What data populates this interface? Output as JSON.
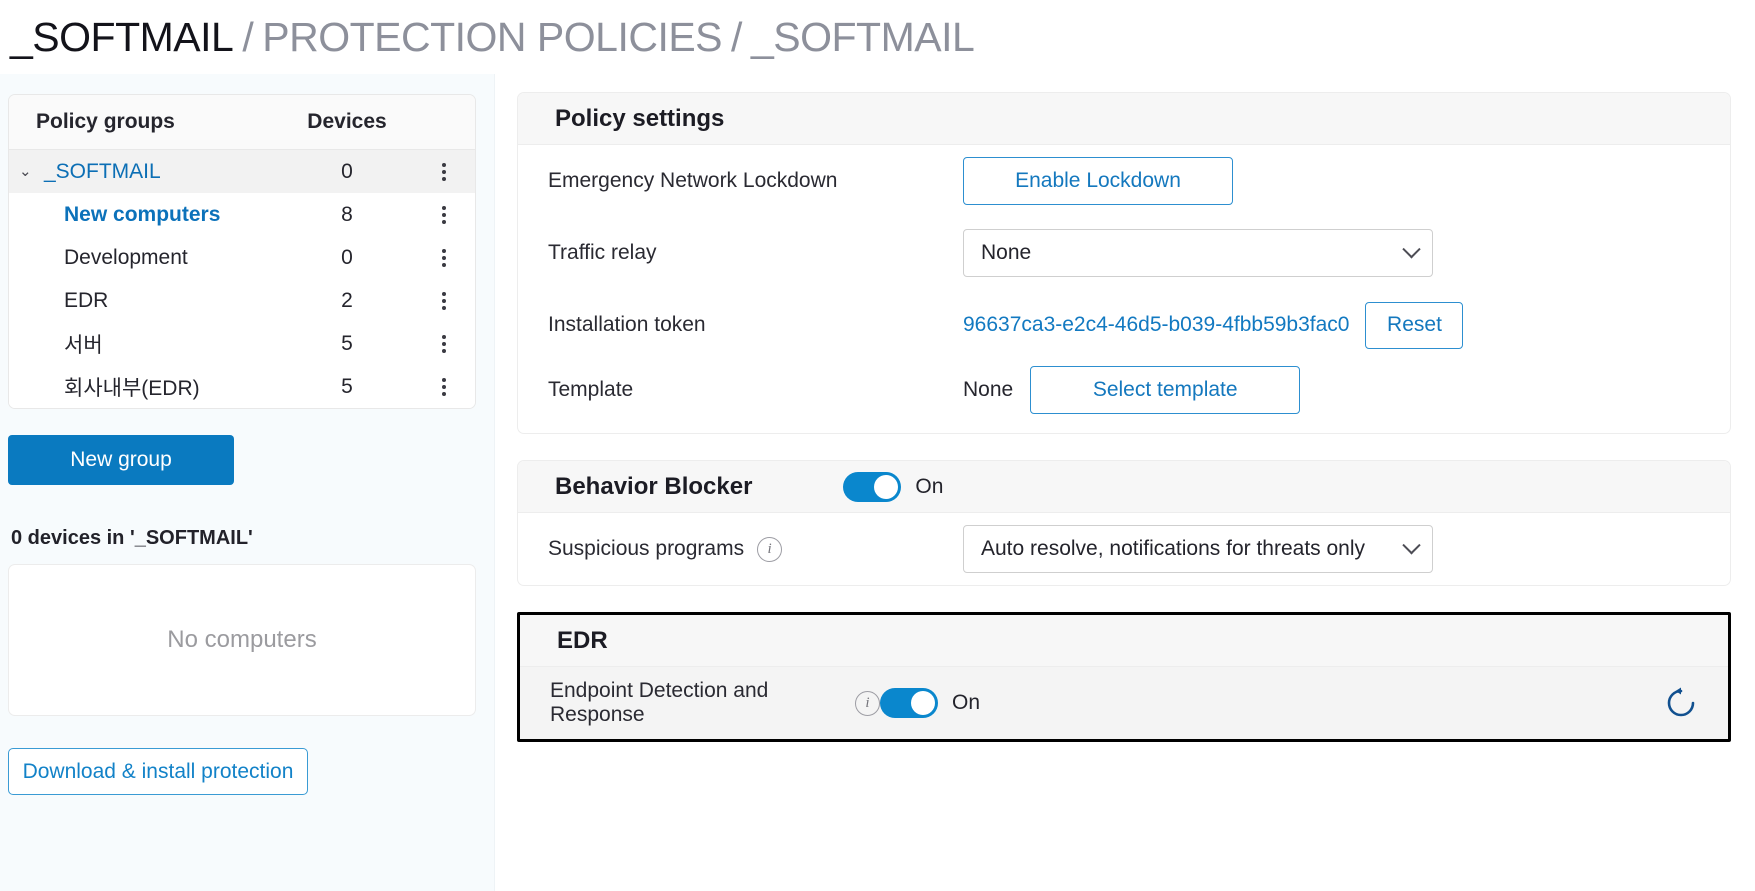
{
  "breadcrumb": {
    "current": "_SOFTMAIL",
    "sep1": "/",
    "section": "PROTECTION POLICIES",
    "sep2": "/",
    "policy": "_SOFTMAIL"
  },
  "sidebar": {
    "table": {
      "headers": {
        "name": "Policy groups",
        "devices": "Devices"
      },
      "rows": [
        {
          "name": "_SOFTMAIL",
          "devices": "0",
          "level": 0,
          "style": "link",
          "selected": true,
          "expanded": true
        },
        {
          "name": "New computers",
          "devices": "8",
          "level": 1,
          "style": "bold-link",
          "selected": false
        },
        {
          "name": "Development",
          "devices": "0",
          "level": 1,
          "style": "plain",
          "selected": false
        },
        {
          "name": "EDR",
          "devices": "2",
          "level": 1,
          "style": "plain",
          "selected": false
        },
        {
          "name": "서버",
          "devices": "5",
          "level": 1,
          "style": "plain",
          "selected": false
        },
        {
          "name": "회사내부(EDR)",
          "devices": "5",
          "level": 1,
          "style": "plain",
          "selected": false
        }
      ]
    },
    "new_group_label": "New group",
    "devices_summary": "0 devices in '_SOFTMAIL'",
    "empty_state": "No computers",
    "download_label": "Download & install protection"
  },
  "policy_settings": {
    "title": "Policy settings",
    "rows": {
      "lockdown": {
        "label": "Emergency Network Lockdown",
        "button": "Enable Lockdown"
      },
      "relay": {
        "label": "Traffic relay",
        "value": "None"
      },
      "token": {
        "label": "Installation token",
        "value": "96637ca3-e2c4-46d5-b039-4fbb59b3fac0",
        "button": "Reset"
      },
      "template": {
        "label": "Template",
        "value": "None",
        "button": "Select template"
      }
    }
  },
  "behavior_blocker": {
    "title": "Behavior Blocker",
    "state": "On",
    "suspicious": {
      "label": "Suspicious programs",
      "value": "Auto resolve, notifications for threats only"
    }
  },
  "edr": {
    "title": "EDR",
    "row": {
      "label": "Endpoint Detection and Response",
      "state": "On"
    }
  },
  "colors": {
    "accent": "#0a7ac0",
    "link": "#1279c1",
    "toggle_on": "#0a87cd",
    "refresh": "#11508f",
    "muted": "#8d909b"
  }
}
